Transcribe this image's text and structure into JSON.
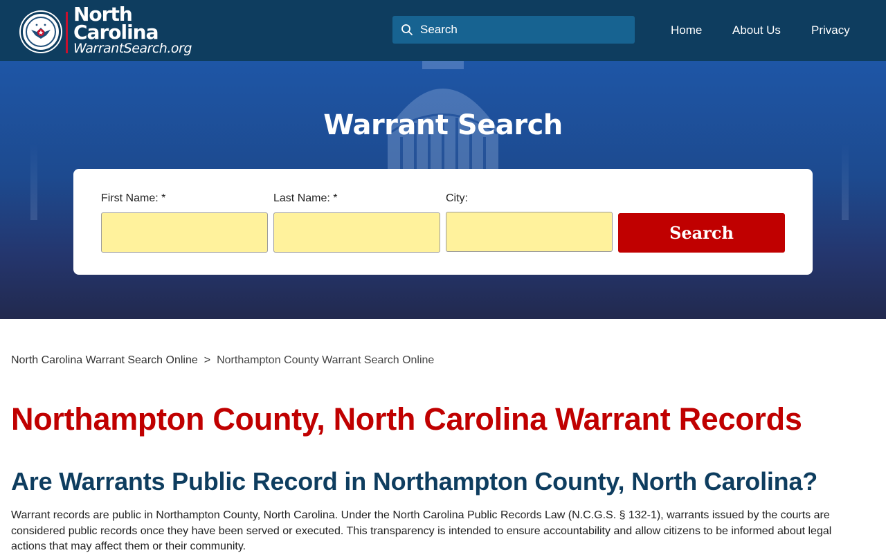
{
  "header": {
    "logo": {
      "seal_text_top": "WARRANT",
      "seal_text_bottom": "SEARCH",
      "line1": "North",
      "line2": "Carolina",
      "line3": "WarrantSearch.org"
    },
    "search": {
      "placeholder": "Search",
      "icon": "search-icon"
    },
    "nav": {
      "home": "Home",
      "about": "About Us",
      "privacy": "Privacy"
    },
    "colors": {
      "bar": "#0e3d5f",
      "search_bg": "#176391"
    }
  },
  "hero": {
    "title": "Warrant Search",
    "form": {
      "first_name_label": "First Name: *",
      "last_name_label": "Last Name: *",
      "city_label": "City:",
      "first_name_value": "",
      "last_name_value": "",
      "city_value": "",
      "submit_label": "Search"
    },
    "colors": {
      "field_bg": "#fff29c",
      "button_bg": "#c00000"
    }
  },
  "breadcrumb": {
    "items": [
      "North Carolina Warrant Search Online",
      "Northampton County Warrant Search Online"
    ],
    "separator": ">"
  },
  "content": {
    "title": "Northampton County, North Carolina Warrant Records",
    "subtitle": "Are Warrants Public Record in Northampton County, North Carolina?",
    "paragraph": "Warrant records are public in Northampton County, North Carolina. Under the North Carolina Public Records Law (N.C.G.S. § 132-1), warrants issued by the courts are considered public records once they have been served or executed. This transparency is intended to ensure accountability and allow citizens to be informed about legal actions that may affect them or their community.",
    "colors": {
      "title": "#c00000",
      "subtitle": "#0e3d5f"
    }
  }
}
